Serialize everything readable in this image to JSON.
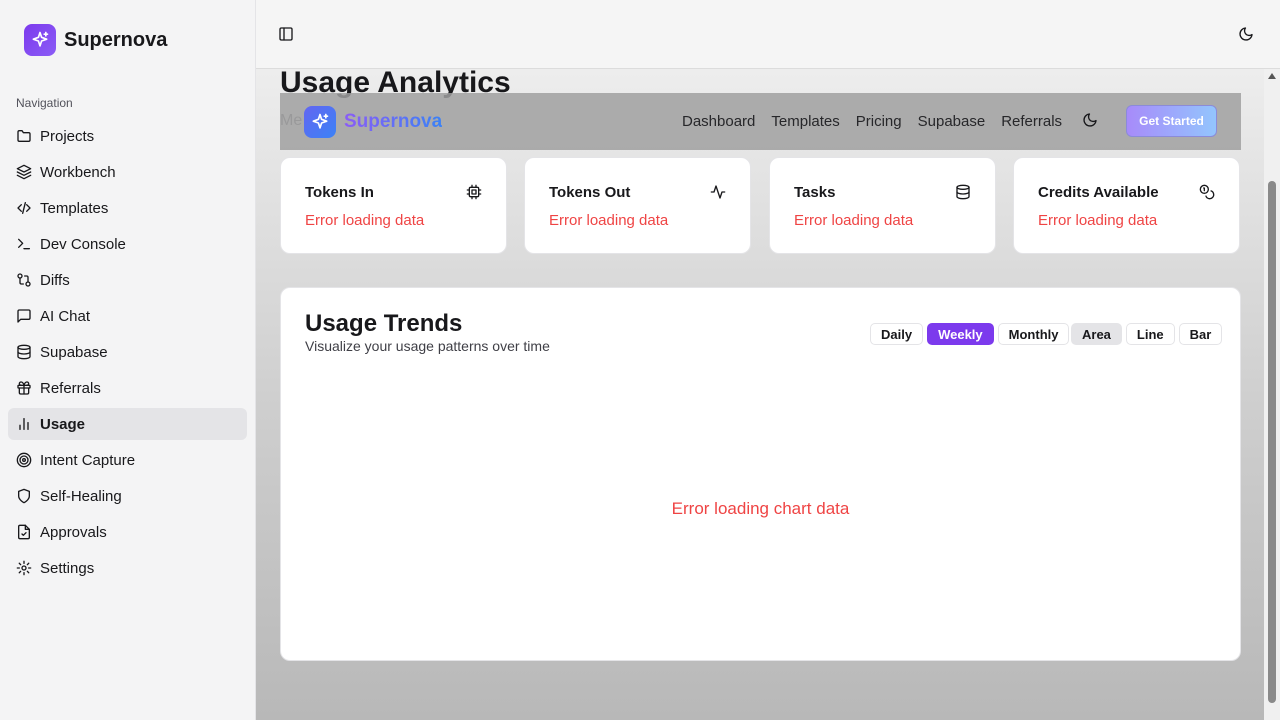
{
  "sidebar": {
    "brand": "Supernova",
    "heading": "Navigation",
    "items": [
      {
        "label": "Projects",
        "icon": "folder-icon"
      },
      {
        "label": "Workbench",
        "icon": "layers-icon"
      },
      {
        "label": "Templates",
        "icon": "code-icon"
      },
      {
        "label": "Dev Console",
        "icon": "terminal-icon"
      },
      {
        "label": "Diffs",
        "icon": "git-compare-icon"
      },
      {
        "label": "AI Chat",
        "icon": "message-square-icon"
      },
      {
        "label": "Supabase",
        "icon": "database-icon"
      },
      {
        "label": "Referrals",
        "icon": "gift-icon"
      },
      {
        "label": "Usage",
        "icon": "bar-chart-icon",
        "active": true
      },
      {
        "label": "Intent Capture",
        "icon": "target-icon"
      },
      {
        "label": "Self-Healing",
        "icon": "shield-icon"
      },
      {
        "label": "Approvals",
        "icon": "file-check-icon"
      },
      {
        "label": "Settings",
        "icon": "gear-icon"
      }
    ]
  },
  "page": {
    "title": "Usage Analytics",
    "subtitle": "Me"
  },
  "overlay_nav": {
    "brand": "Supernova",
    "links": [
      "Dashboard",
      "Templates",
      "Pricing",
      "Supabase",
      "Referrals"
    ],
    "cta": "Get Started"
  },
  "stats": [
    {
      "title": "Tokens In",
      "icon": "cpu-icon",
      "error": "Error loading data"
    },
    {
      "title": "Tokens Out",
      "icon": "activity-icon",
      "error": "Error loading data"
    },
    {
      "title": "Tasks",
      "icon": "database-icon",
      "error": "Error loading data"
    },
    {
      "title": "Credits Available",
      "icon": "coins-icon",
      "error": "Error loading data"
    }
  ],
  "trends": {
    "title": "Usage Trends",
    "subtitle": "Visualize your usage patterns over time",
    "range_options": [
      "Daily",
      "Weekly",
      "Monthly"
    ],
    "range_selected": "Weekly",
    "type_options": [
      "Area",
      "Line",
      "Bar"
    ],
    "type_selected": "Area",
    "error": "Error loading chart data"
  },
  "colors": {
    "accent": "#7c3aed",
    "error": "#ef4444"
  }
}
